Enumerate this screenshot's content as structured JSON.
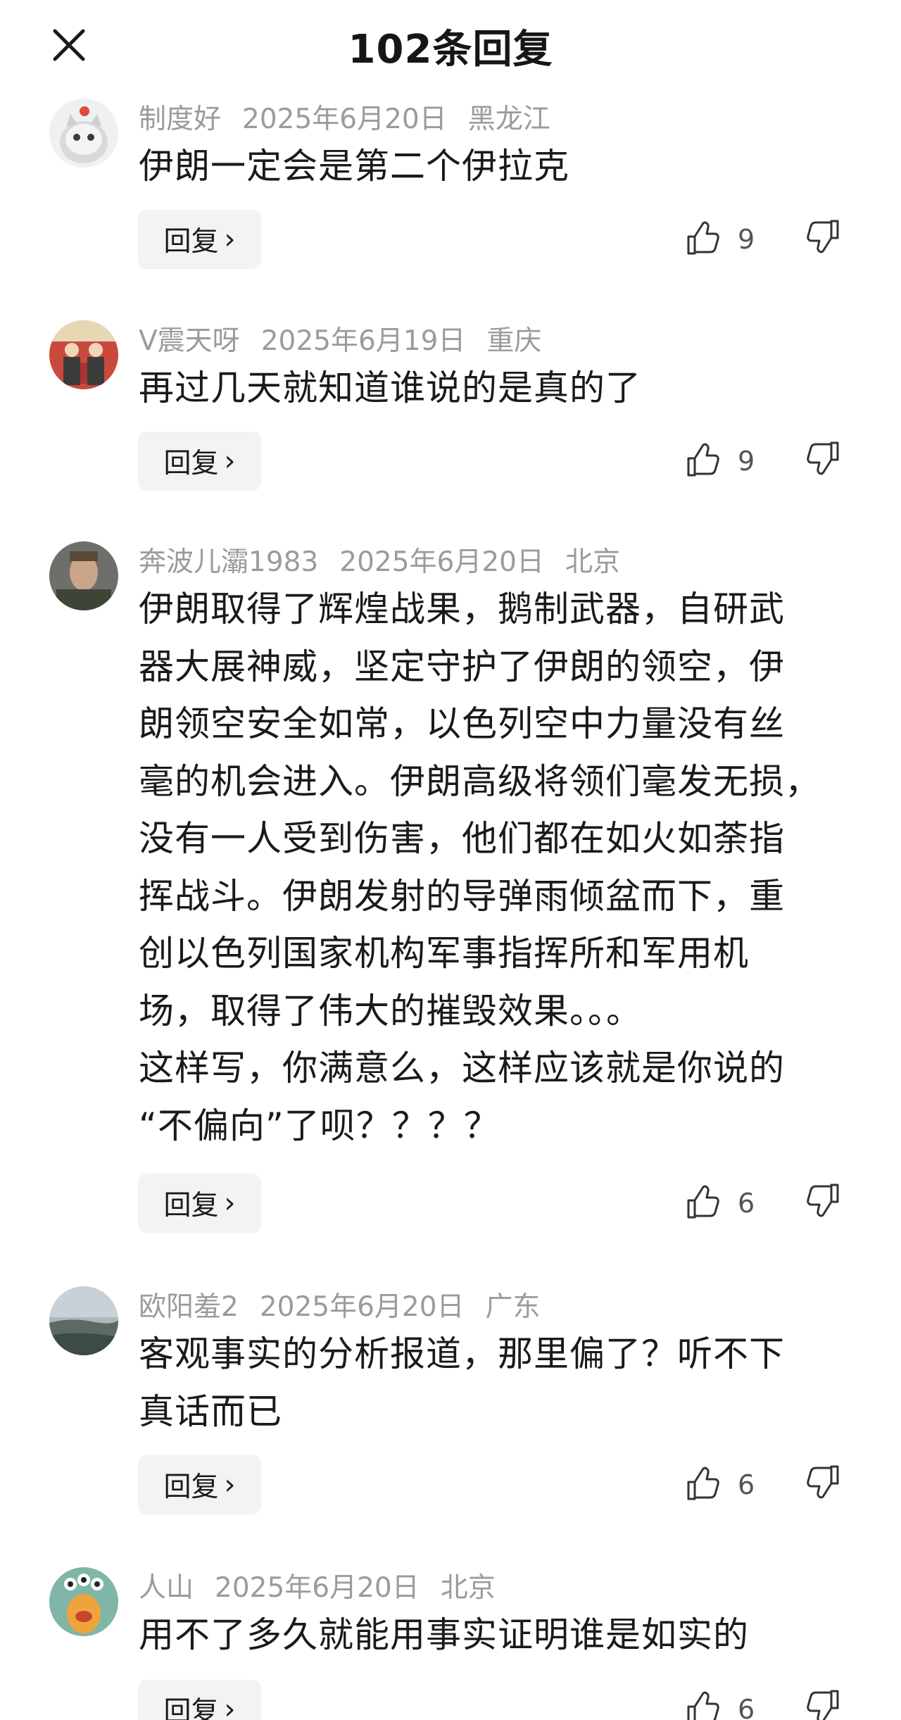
{
  "header": {
    "title": "102条回复",
    "close_icon": "close-icon"
  },
  "comments": [
    {
      "user": "制度好",
      "date": "2025年6月20日",
      "location": "黑龙江",
      "lines": [
        "伊朗一定会是第二个伊拉克"
      ],
      "reply_label": "回复",
      "likes": "9"
    },
    {
      "user": "V震天呀",
      "date": "2025年6月19日",
      "location": "重庆",
      "lines": [
        "再过几天就知道谁说的是真的了"
      ],
      "reply_label": "回复",
      "likes": "9"
    },
    {
      "user": "奔波儿灞1983",
      "date": "2025年6月20日",
      "location": "北京",
      "lines": [
        "伊朗取得了辉煌战果，鹅制武器，自研武",
        "器大展神威，坚定守护了伊朗的领空，伊",
        "朗领空安全如常，以色列空中力量没有丝",
        "毫的机会进入。伊朗高级将领们毫发无损，",
        "没有一人受到伤害，他们都在如火如荼指",
        "挥战斗。伊朗发射的导弹雨倾盆而下，重",
        "创以色列国家机构军事指挥所和军用机",
        "场，取得了伟大的摧毁效果。。。",
        "这样写，你满意么，这样应该就是你说的",
        "“不偏向”了呗？？？？"
      ],
      "reply_label": "回复",
      "likes": "6"
    },
    {
      "user": "欧阳羞2",
      "date": "2025年6月20日",
      "location": "广东",
      "lines": [
        "客观事实的分析报道，那里偏了？听不下",
        "真话而已"
      ],
      "reply_label": "回复",
      "likes": "6"
    },
    {
      "user": "人山",
      "date": "2025年6月20日",
      "location": "北京",
      "lines": [
        "用不了多久就能用事实证明谁是如实的"
      ],
      "reply_label": "回复",
      "likes": "6"
    }
  ],
  "icons": {
    "like": "thumbs-up-icon",
    "dislike": "thumbs-down-icon",
    "reply_chevron": "chevron-right-icon"
  }
}
